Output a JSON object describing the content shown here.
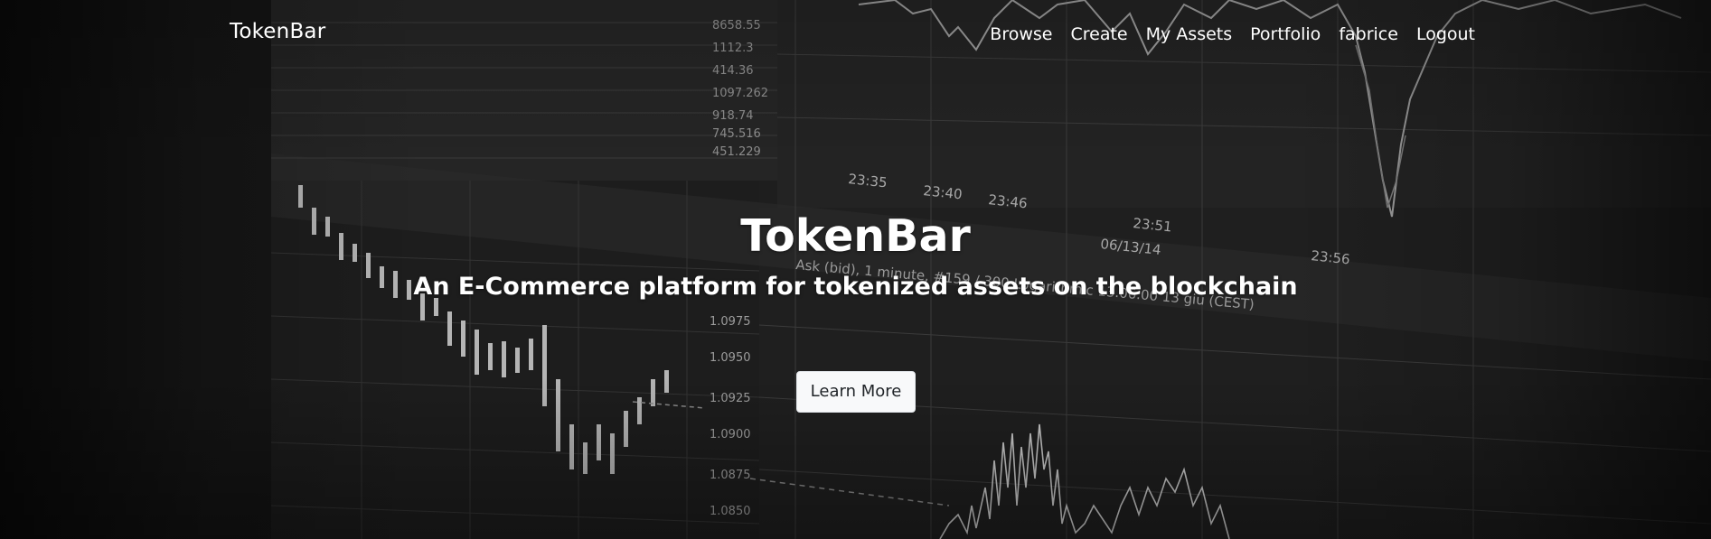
{
  "navbar": {
    "brand": "TokenBar",
    "links": [
      "Browse",
      "Create",
      "My Assets",
      "Portfolio",
      "fabrice",
      "Logout"
    ]
  },
  "hero": {
    "title": "TokenBar",
    "subtitle": "An E-Commerce platform for tokenized assets on the blockchain",
    "cta_label": "Learn More",
    "background_image": "blurred-trading-chart-monitor"
  },
  "background_screen": {
    "time_labels": [
      "23:35",
      "23:40",
      "23:46",
      "23:51",
      "06/13/14",
      "23:56"
    ],
    "table_values": [
      "8658.55",
      "1112.3",
      "414.36",
      "1097.262",
      "918.74",
      "745.516",
      "451.229"
    ],
    "axis_values": [
      "1.0975",
      "1.0950",
      "1.0925",
      "1.0900",
      "1.0875",
      "1.0850"
    ],
    "legend_text": "Ask (bid), 1 minute, #159 / 300  Logarithmic  13.06.00  13 giu (CEST)"
  },
  "colors": {
    "background": "#1b1b1b",
    "text": "#ffffff",
    "button_bg": "#f8f9fa",
    "button_text": "#212529"
  }
}
